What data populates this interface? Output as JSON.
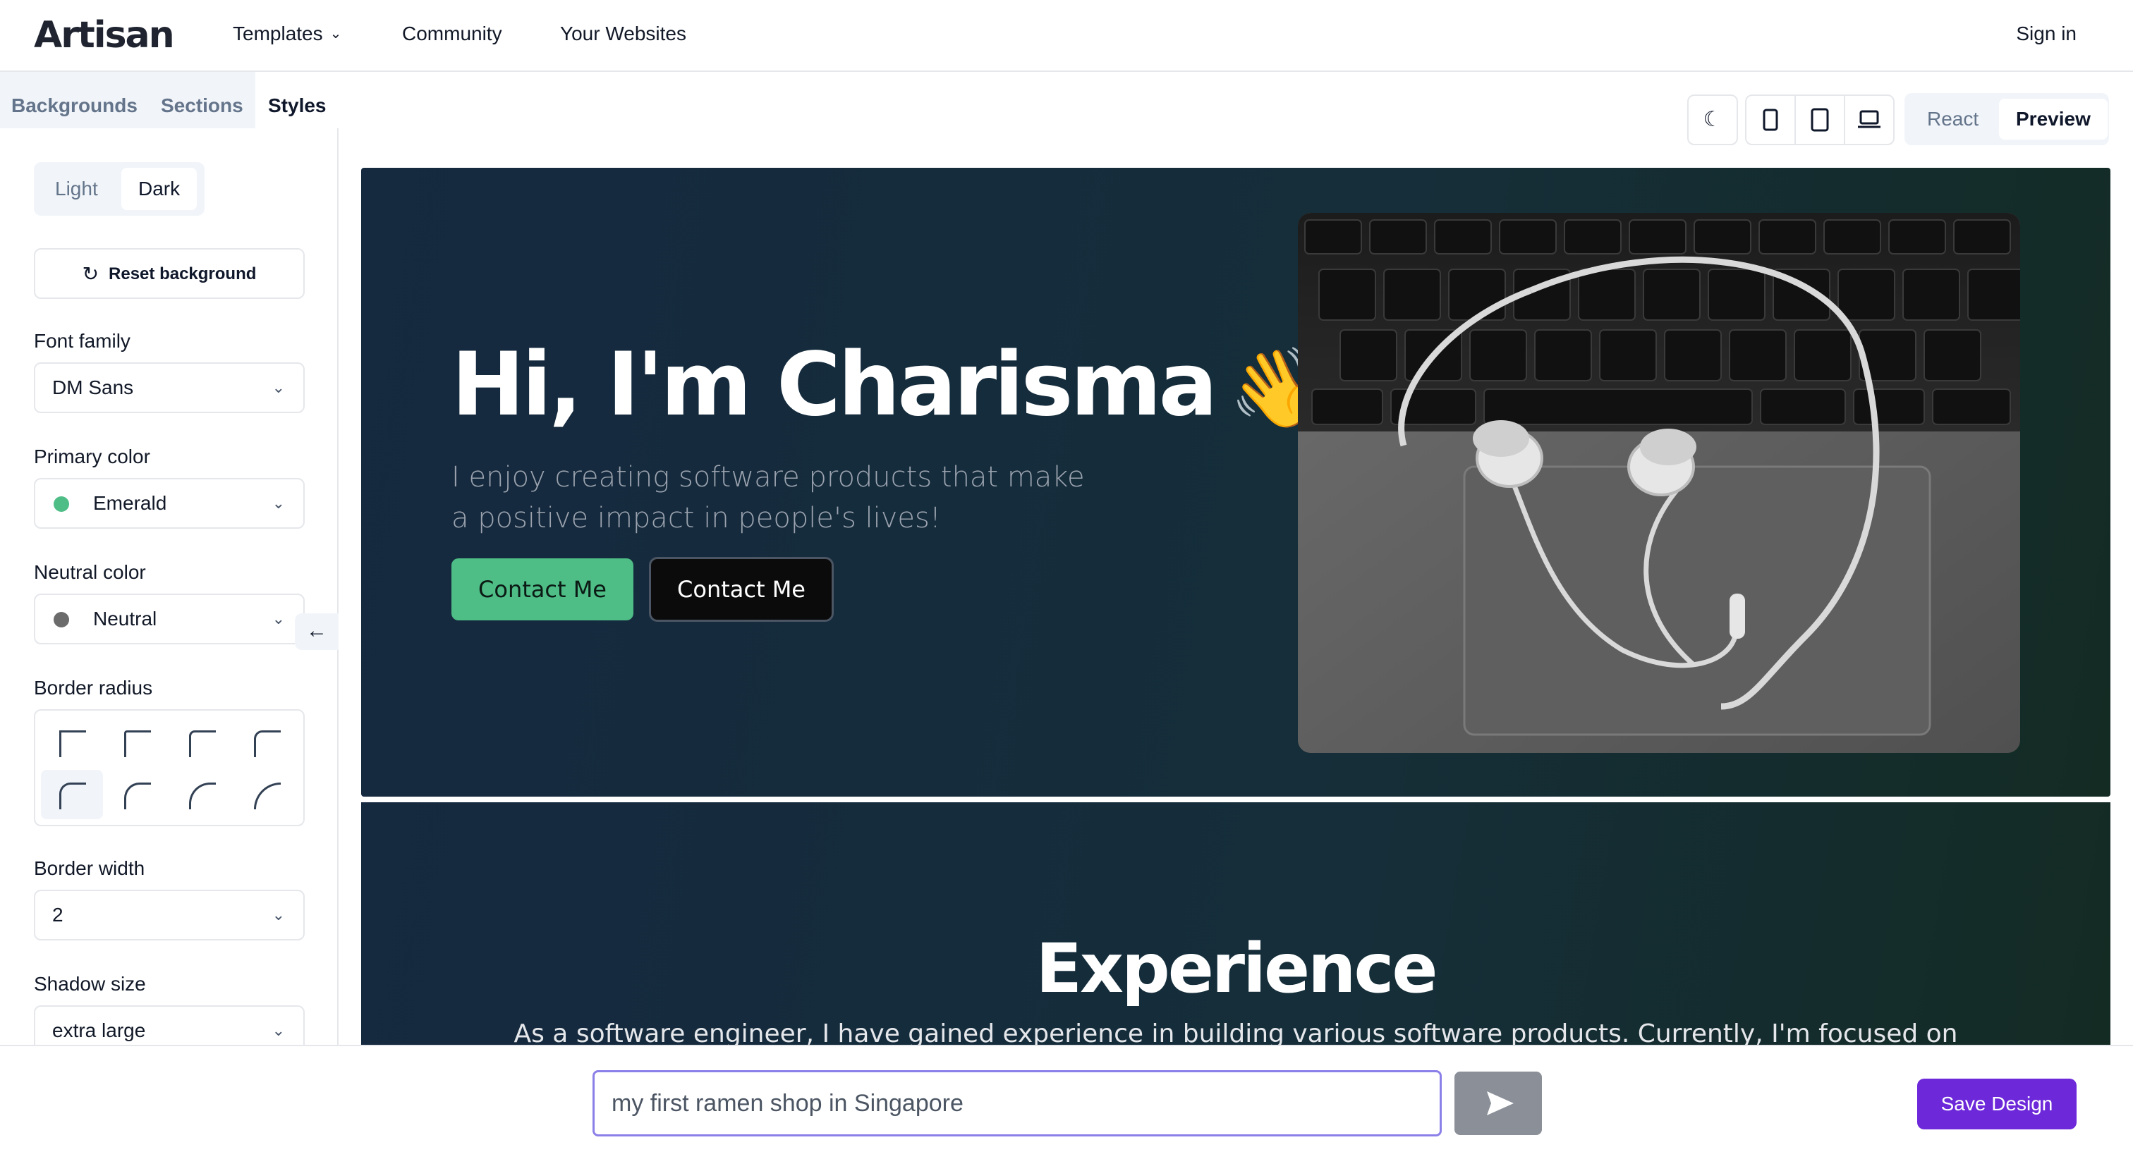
{
  "header": {
    "logo": "Artisan",
    "nav": [
      "Templates",
      "Community",
      "Your Websites"
    ],
    "templates_chevron": "⌄",
    "sign_in": "Sign in"
  },
  "sidebar": {
    "tabs": [
      "Backgrounds",
      "Sections",
      "Styles"
    ],
    "active_tab": "Styles",
    "theme_toggle": {
      "options": [
        "Light",
        "Dark"
      ],
      "selected": "Dark"
    },
    "reset_label": "Reset background",
    "font_family": {
      "label": "Font family",
      "value": "DM Sans"
    },
    "primary_color": {
      "label": "Primary color",
      "value": "Emerald",
      "swatch": "#4ebd86"
    },
    "neutral_color": {
      "label": "Neutral color",
      "value": "Neutral",
      "swatch": "#6b6b6b"
    },
    "border_radius": {
      "label": "Border radius",
      "selected_index": 4
    },
    "border_width": {
      "label": "Border width",
      "value": "2"
    },
    "shadow_size": {
      "label": "Shadow size",
      "value": "extra large"
    }
  },
  "toolbar": {
    "icons": [
      "moon-icon",
      "mobile-icon",
      "tablet-icon",
      "laptop-icon"
    ],
    "modes": [
      "React",
      "Preview"
    ],
    "active_mode": "Preview"
  },
  "preview": {
    "hero": {
      "title": "Hi, I'm Charisma",
      "emoji": "👋",
      "subtitle": "I enjoy creating software products that make a positive impact in people's lives!",
      "button_primary": "Contact Me",
      "button_secondary": "Contact Me"
    },
    "experience": {
      "title": "Experience",
      "text": "As a software engineer, I have gained experience in building various software products. Currently, I'm focused on"
    }
  },
  "bottom": {
    "prompt_value": "my first ramen shop in Singapore",
    "save_label": "Save Design"
  },
  "colors": {
    "accent": "#6d28d9",
    "emerald": "#4ebd86",
    "hero_bg": "#15293f"
  }
}
